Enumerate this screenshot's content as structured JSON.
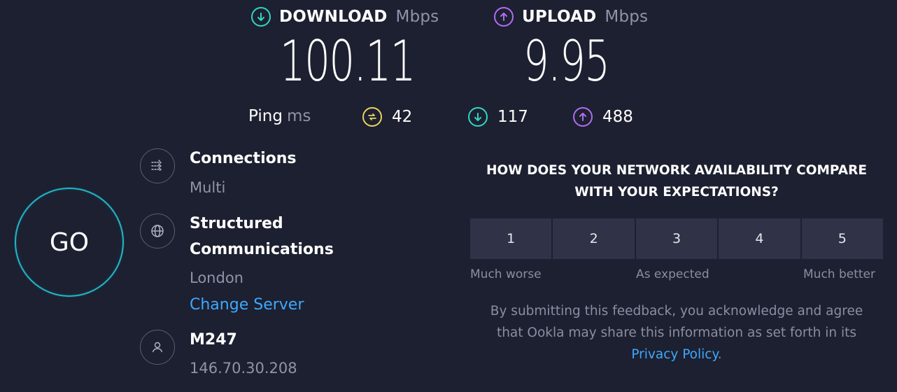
{
  "download": {
    "label": "DOWNLOAD",
    "unit": "Mbps",
    "value": "100.11",
    "icon": "arrow-down-circle-icon",
    "color": "#2fd6c5"
  },
  "upload": {
    "label": "UPLOAD",
    "unit": "Mbps",
    "value": "9.95",
    "icon": "arrow-up-circle-icon",
    "color": "#b26cf3"
  },
  "ping": {
    "label": "Ping",
    "unit": "ms",
    "idle": "42",
    "download": "117",
    "upload": "488",
    "idle_color": "#e9d35f"
  },
  "go_label": "GO",
  "server": {
    "connections_title": "Connections",
    "connections_value": "Multi",
    "provider_line1": "Structured",
    "provider_line2": "Communications",
    "location": "London",
    "change_server": "Change Server",
    "user_isp": "M247",
    "ip": "146.70.30.208"
  },
  "survey": {
    "question_line1": "HOW DOES YOUR NETWORK AVAILABILITY COMPARE",
    "question_line2": "WITH YOUR EXPECTATIONS?",
    "ratings": [
      "1",
      "2",
      "3",
      "4",
      "5"
    ],
    "low_label": "Much worse",
    "mid_label": "As expected",
    "high_label": "Much better",
    "disclaimer_line1": "By submitting this feedback, you acknowledge and agree",
    "disclaimer_line2": "that Ookla may share this information as set forth in its",
    "privacy_link": "Privacy Policy",
    "privacy_suffix": "."
  },
  "colors": {
    "background": "#1d2030",
    "accent_link": "#3ea8ff",
    "go_ring": "#1fb7c9"
  }
}
